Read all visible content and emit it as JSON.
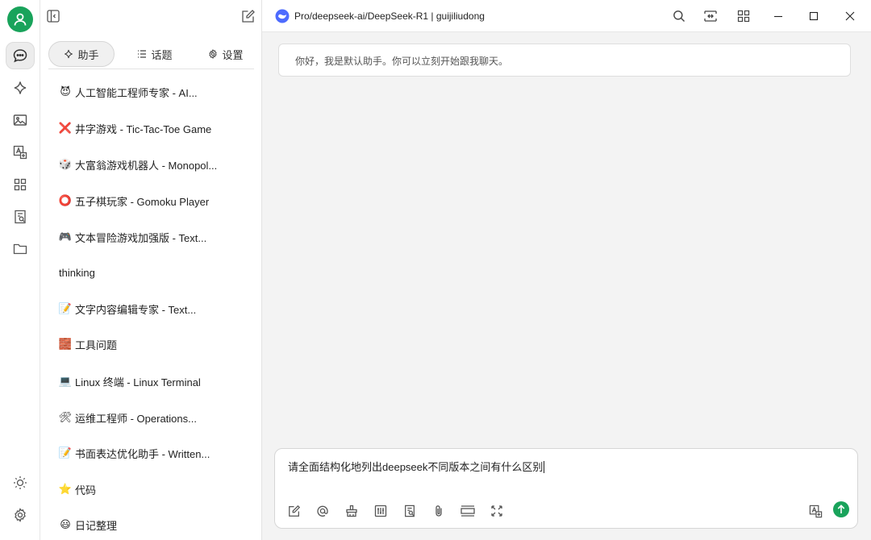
{
  "app": {
    "model_label": "Pro/deepseek-ai/DeepSeek-R1 | guijiliudong"
  },
  "sidebar": {
    "tabs": [
      {
        "label": "助手",
        "icon": "sparkle-icon"
      },
      {
        "label": "话题",
        "icon": "list-icon"
      },
      {
        "label": "设置",
        "icon": "gear-icon"
      }
    ],
    "items": [
      {
        "emoji": "😈",
        "label": "人工智能工程师专家 - AI..."
      },
      {
        "emoji": "❌",
        "label": "井字游戏 - Tic-Tac-Toe Game"
      },
      {
        "emoji": "🎲",
        "label": "大富翁游戏机器人 - Monopol..."
      },
      {
        "emoji": "⭕",
        "label": "五子棋玩家 - Gomoku Player"
      },
      {
        "emoji": "🎮",
        "label": "文本冒险游戏加强版 - Text..."
      },
      {
        "emoji": "",
        "label": "thinking"
      },
      {
        "emoji": "📝",
        "label": "文字内容编辑专家 - Text..."
      },
      {
        "emoji": "🧱",
        "label": "工具问题"
      },
      {
        "emoji": "💻",
        "label": "Linux 终端 - Linux Terminal"
      },
      {
        "emoji": "🛠",
        "label": "运维工程师 - Operations..."
      },
      {
        "emoji": "📝",
        "label": "书面表达优化助手 - Written..."
      },
      {
        "emoji": "⭐",
        "label": "代码"
      },
      {
        "emoji": "😃",
        "label": "日记整理"
      }
    ]
  },
  "main": {
    "greeting": "你好，我是默认助手。你可以立刻开始跟我聊天。",
    "input_value": "请全面结构化地列出deepseek不同版本之间有什么区别"
  },
  "colors": {
    "accent": "#19a35b",
    "main_bg": "#f3f3f3"
  }
}
